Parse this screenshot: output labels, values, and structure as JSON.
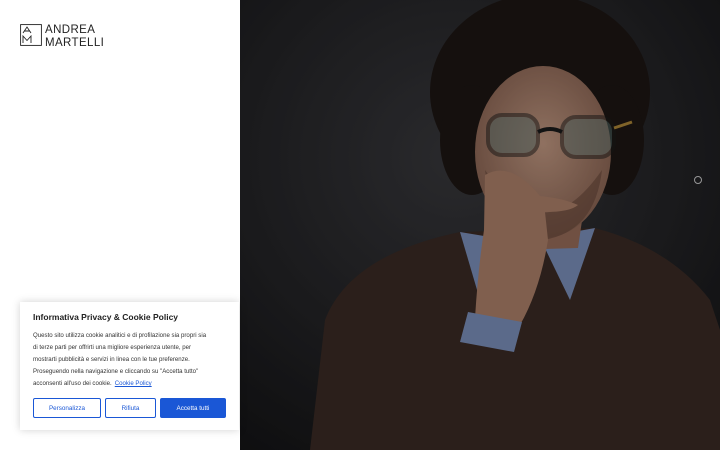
{
  "header": {
    "logo_line1": "ANDREA",
    "logo_line2": "MARTELLI",
    "logo_mark": "AM"
  },
  "hero": {
    "image_icon": "portrait-photo"
  },
  "cookie_banner": {
    "title": "Informativa Privacy & Cookie Policy",
    "text_lines": [
      "Questo sito utilizza cookie analitici e di profilazione sia propri sia",
      "di terze parti per offrirti una migliore esperienza utente, per",
      "mostrarti pubblicità e servizi in linea con le tue preferenze.",
      "Proseguendo nella navigazione e cliccando su \"Accetta tutto\"",
      "acconsenti all'uso dei cookie."
    ],
    "link_text": "Cookie Policy",
    "buttons": {
      "customize": "Personalizza",
      "reject": "Rifiuta",
      "accept": "Accetta tutti"
    },
    "accent_color": "#1a57d6"
  }
}
